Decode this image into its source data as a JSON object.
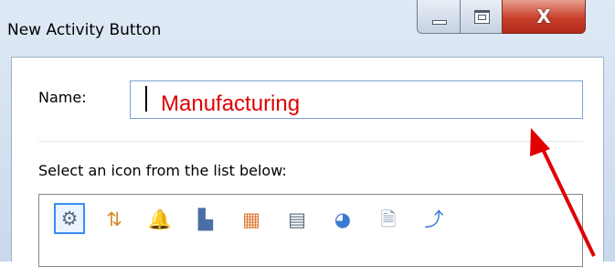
{
  "window": {
    "title": "New Activity Button",
    "controls": {
      "minimize": "minimize",
      "maximize": "maximize",
      "close": "close"
    },
    "close_glyph": "X"
  },
  "form": {
    "name_label": "Name:",
    "name_value": "",
    "name_overlay_text": "Manufacturing",
    "select_label": "Select an icon from the list below:"
  },
  "icons": [
    {
      "name": "gears-icon",
      "glyph": "⚙",
      "color": "#5b6b7d",
      "selected": true
    },
    {
      "name": "chart-swap-icon",
      "glyph": "⇅",
      "color": "#d9892a"
    },
    {
      "name": "bell-icon",
      "glyph": "🔔",
      "color": "#f2c94c"
    },
    {
      "name": "chart-search-icon",
      "glyph": "▙",
      "color": "#4a6fa5"
    },
    {
      "name": "document-chart-icon",
      "glyph": "▦",
      "color": "#e07b39"
    },
    {
      "name": "calculator-icon",
      "glyph": "▤",
      "color": "#5b6b7d"
    },
    {
      "name": "globe-icon",
      "glyph": "◕",
      "color": "#3a7ad0"
    },
    {
      "name": "document-check-icon",
      "glyph": "🗎",
      "color": "#8aa0b8"
    },
    {
      "name": "axis-arrow-icon",
      "glyph": "⤴",
      "color": "#3a7ad0"
    }
  ],
  "annotation": {
    "arrow_color": "#e00000"
  },
  "colors": {
    "input_border": "#7aa3d6",
    "selection_border": "#3a8cf0",
    "overlay_text": "#e00000"
  }
}
